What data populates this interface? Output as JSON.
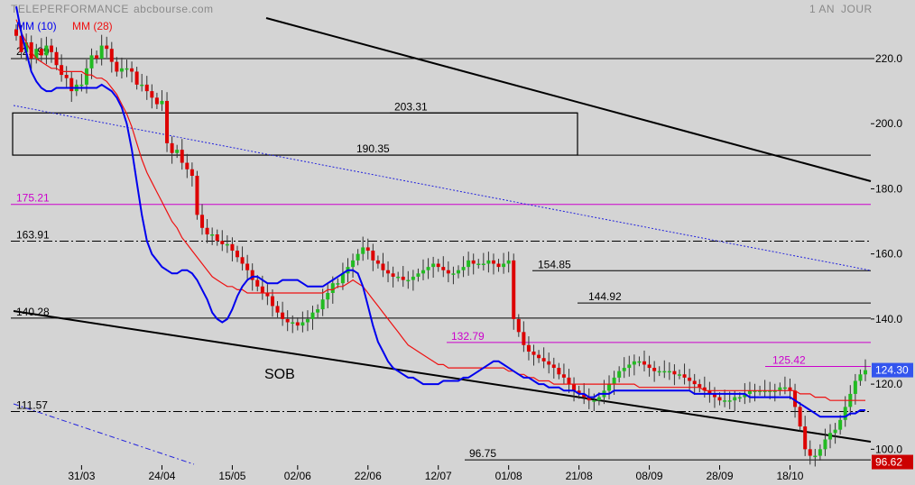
{
  "header": {
    "instrument": "TELEPERFORMANCE",
    "source": "abcbourse.com",
    "period": "1 AN",
    "interval": "JOUR"
  },
  "legend": {
    "ma_fast": "MM (10)",
    "ma_slow": "MM (28)"
  },
  "colors": {
    "background": "#d4d4d4",
    "up_candle": "#22bb22",
    "down_candle": "#dd0000",
    "ma_fast": "#0000ee",
    "ma_slow": "#ee1111",
    "trendline": "#000000",
    "level_magenta": "#cc00cc",
    "last_price_badge": "#3355ee",
    "low_badge": "#cc0000"
  },
  "chart_data": {
    "type": "candlestick",
    "title": "TELEPERFORMANCE",
    "ylim": [
      94,
      238
    ],
    "y_ticks": [
      "220.0",
      "200.0",
      "180.0",
      "160.0",
      "140.0",
      "120.0",
      "100.0"
    ],
    "y_tick_values": [
      220,
      200,
      180,
      160,
      140,
      120,
      100
    ],
    "x_ticks": [
      "31/03",
      "24/04",
      "15/05",
      "02/06",
      "22/06",
      "12/07",
      "01/08",
      "21/08",
      "08/09",
      "28/09",
      "18/10"
    ],
    "x_tick_index": [
      13,
      29,
      43,
      56,
      70,
      84,
      98,
      112,
      126,
      140,
      154
    ],
    "n_candles": 170,
    "candle_closes": [
      227,
      222,
      225,
      220,
      223,
      221,
      224,
      222,
      218,
      215,
      214,
      210,
      212,
      212,
      217,
      221,
      220,
      224,
      223,
      219,
      216,
      217,
      217,
      216,
      212,
      212,
      210,
      208,
      206,
      207,
      194,
      191,
      192,
      188,
      186,
      184,
      172,
      168,
      166,
      166,
      164,
      163,
      163,
      161,
      159,
      157,
      155,
      152,
      150,
      148,
      147,
      144,
      142,
      140,
      139,
      139,
      138,
      139,
      140,
      142,
      143,
      146,
      148,
      151,
      151,
      154,
      156,
      158,
      160,
      162,
      161,
      158,
      157,
      155,
      154,
      153,
      153,
      152,
      152,
      153,
      154,
      155,
      156,
      157,
      156,
      155,
      154,
      154,
      155,
      156,
      158,
      157,
      157,
      157,
      158,
      157,
      156,
      157,
      158,
      140,
      136,
      132,
      130,
      129,
      128,
      127,
      126,
      125,
      123,
      122,
      120,
      118,
      117,
      116,
      115,
      115,
      116,
      118,
      120,
      122,
      124,
      125,
      126,
      127,
      127,
      126,
      125,
      124,
      124,
      124,
      124,
      123,
      123,
      122,
      121,
      120,
      119,
      118,
      117,
      116,
      115,
      115,
      115,
      116,
      116,
      117,
      118,
      118,
      118,
      118,
      118,
      118,
      119,
      119,
      118,
      113,
      107,
      100,
      98,
      98,
      100,
      103,
      105,
      106,
      109,
      113,
      117,
      121,
      123,
      124.3
    ],
    "ma_fast_values": [
      236,
      228,
      222,
      216,
      213,
      211,
      210,
      210,
      211,
      211,
      211,
      211,
      211,
      211,
      211,
      211,
      211,
      212,
      211,
      210,
      208,
      205,
      200,
      192,
      182,
      172,
      164,
      160,
      158,
      156,
      155,
      154,
      154,
      155,
      155,
      154,
      152,
      149,
      146,
      142,
      140,
      139,
      140,
      143,
      147,
      150,
      152,
      153,
      153,
      152,
      151,
      151,
      151,
      152,
      152,
      152,
      152,
      151,
      150,
      150,
      150,
      150,
      151,
      152,
      153,
      154,
      155,
      155,
      154,
      150,
      144,
      138,
      133,
      130,
      127,
      125,
      124,
      123,
      122,
      122,
      121,
      120,
      120,
      120,
      120,
      121,
      121,
      121,
      121,
      122,
      122,
      123,
      124,
      125,
      126,
      127,
      127,
      126,
      125,
      124,
      123,
      122,
      122,
      121,
      120,
      120,
      119,
      119,
      119,
      118,
      118,
      118,
      117,
      117,
      116,
      116,
      117,
      117,
      117,
      118,
      118,
      118,
      118,
      118,
      118,
      118,
      118,
      118,
      118,
      118,
      118,
      118,
      118,
      118,
      118,
      117,
      117,
      117,
      117,
      117,
      117,
      117,
      117,
      117,
      117,
      117,
      116,
      116,
      116,
      116,
      116,
      116,
      116,
      116,
      116,
      115,
      114,
      113,
      112,
      111,
      110,
      110,
      110,
      110,
      110,
      110,
      111,
      111,
      112,
      112
    ],
    "ma_slow_values": [
      232,
      228,
      225,
      222,
      220,
      219,
      218,
      217,
      217,
      216,
      216,
      216,
      216,
      216,
      215,
      215,
      214,
      214,
      213,
      211,
      209,
      206,
      203,
      199,
      194,
      189,
      185,
      182,
      179,
      176,
      173,
      170,
      168,
      165,
      163,
      161,
      159,
      157,
      155,
      153,
      152,
      151,
      150,
      150,
      149,
      149,
      148,
      148,
      148,
      148,
      148,
      148,
      148,
      148,
      148,
      148,
      148,
      148,
      148,
      148,
      148,
      148,
      149,
      149,
      150,
      150,
      151,
      152,
      151,
      150,
      148,
      146,
      144,
      142,
      140,
      138,
      136,
      134,
      132,
      131,
      130,
      129,
      128,
      127,
      126,
      126,
      125,
      125,
      125,
      125,
      125,
      125,
      125,
      125,
      125,
      125,
      125,
      125,
      124,
      124,
      123,
      123,
      122,
      122,
      121,
      121,
      121,
      120,
      120,
      120,
      120,
      120,
      120,
      120,
      120,
      120,
      120,
      120,
      120,
      120,
      120,
      120,
      120,
      120,
      119,
      119,
      119,
      119,
      119,
      119,
      119,
      119,
      119,
      119,
      119,
      119,
      119,
      118,
      118,
      118,
      118,
      118,
      118,
      118,
      118,
      118,
      118,
      118,
      118,
      118,
      118,
      118,
      118,
      118,
      118,
      118,
      117,
      117,
      117,
      116,
      116,
      116,
      115,
      115,
      115,
      115,
      115,
      115,
      115,
      115
    ],
    "levels": [
      {
        "value": 220.0,
        "label": "",
        "style": "solid",
        "color": "#000000"
      },
      {
        "value": 203.31,
        "label": "203.31",
        "style": "solid",
        "color": "#000000"
      },
      {
        "value": 190.35,
        "label": "190.35",
        "style": "solid",
        "color": "#000000"
      },
      {
        "value": 175.21,
        "label": "175.21",
        "style": "solid",
        "color": "#cc00cc"
      },
      {
        "value": 163.91,
        "label": "163.91",
        "style": "dashdot",
        "color": "#000000"
      },
      {
        "value": 154.85,
        "label": "154.85",
        "style": "solid",
        "color": "#000000"
      },
      {
        "value": 144.92,
        "label": "144.92",
        "style": "solid",
        "color": "#000000"
      },
      {
        "value": 140.28,
        "label": "140.28",
        "style": "solid",
        "color": "#000000"
      },
      {
        "value": 132.79,
        "label": "132.79",
        "style": "solid",
        "color": "#cc00cc"
      },
      {
        "value": 125.42,
        "label": "125.42",
        "style": "solid",
        "color": "#cc00cc"
      },
      {
        "value": 111.57,
        "label": "111.57",
        "style": "dashdot",
        "color": "#000000"
      },
      {
        "value": 96.75,
        "label": "96.75",
        "style": "solid",
        "color": "#000000"
      }
    ],
    "first_level_label": "221.99",
    "annotation_text": "SOB",
    "last_price": "124.30",
    "low_price": "96.62",
    "grid": false
  }
}
